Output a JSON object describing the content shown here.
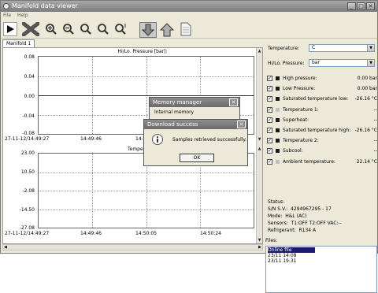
{
  "window": {
    "title": "Manifold data viewer"
  },
  "menu": {
    "items": [
      "File",
      "Help"
    ]
  },
  "toolbar": {
    "icons": [
      "play-icon",
      "delete-icon",
      "zoom-in-icon",
      "zoom-out-icon",
      "zoom-x-icon",
      "zoom-reset-icon",
      "zoom-y-icon",
      "download-icon",
      "upload-icon",
      "document-icon"
    ]
  },
  "tabs": [
    {
      "label": "Manifold 1"
    }
  ],
  "chart_data": [
    {
      "type": "line",
      "title": "Hi/Lo. Pressure [bar]:",
      "ylim": [
        -0.08,
        0.08
      ],
      "yticks": [
        "0.08",
        "0.04",
        "0.00",
        "-0.04",
        "-0.08"
      ],
      "xticks": [
        "27-11-12/14:49:27",
        "14:49:46",
        "14:"
      ],
      "series": []
    },
    {
      "type": "line",
      "title": "Temperature",
      "ylim": [
        -27.8,
        23.0
      ],
      "yticks": [
        "23.00",
        "10.50",
        "-2.08",
        "-14.50",
        "-27.08"
      ],
      "xticks": [
        "27-11-12/14:49:27",
        "14:49:46",
        "14:50:05",
        "14:50:24"
      ],
      "series": []
    }
  ],
  "side": {
    "temperature_label": "Temperature:",
    "temperature_unit": "C",
    "pressure_label": "Hi/Lo. Pressure:",
    "pressure_unit": "bar",
    "channels": [
      {
        "label": "High pressure:",
        "value": "0.00 bar",
        "checked": true,
        "swatch": "#1a1a1a"
      },
      {
        "label": "Low Pressure:",
        "value": "0.00 bar",
        "checked": true,
        "swatch": "#1a1a1a"
      },
      {
        "label": "Saturated temperature low:",
        "value": "-26.16 °C",
        "checked": true,
        "swatch": "#1a1a1a"
      },
      {
        "label": "Temperature 1:",
        "value": "--",
        "checked": true,
        "swatch": "#bfbfbf"
      },
      {
        "label": "Superheat:",
        "value": "--",
        "checked": true,
        "swatch": "#1a1a1a"
      },
      {
        "label": "Saturated temperature high:",
        "value": "-26.16 °C",
        "checked": true,
        "swatch": "#1a1a1a"
      },
      {
        "label": "Temperature 2:",
        "value": "--",
        "checked": true,
        "swatch": "#1a1a1a"
      },
      {
        "label": "Subcool:",
        "value": "--",
        "checked": true,
        "swatch": "#1a1a1a"
      },
      {
        "label": "Ambient temperature:",
        "value": "22.14 °C",
        "checked": true,
        "swatch": "#bfbfbf"
      }
    ],
    "status": {
      "heading": "Status:",
      "rows": [
        {
          "key": "S/N S.V.:",
          "value": "4294967295 - 17"
        },
        {
          "key": "Mode:",
          "value": "H&L (AC)"
        },
        {
          "key": "Sensors:",
          "value": "T1:OFF T2:OFF VAC:--"
        },
        {
          "key": "Refrigerant:",
          "value": "R134 A"
        }
      ]
    },
    "files_label": "Files:",
    "files": [
      "Online file",
      "23/11 14:08",
      "23/11 19:31"
    ]
  },
  "memory_dialog": {
    "title": "Memory manager",
    "group_label": "Internal memory",
    "close": "✕"
  },
  "success_dialog": {
    "title": "Download success",
    "message": "Samples retrieved successfully.",
    "ok_label": "OK",
    "close": "✕"
  }
}
